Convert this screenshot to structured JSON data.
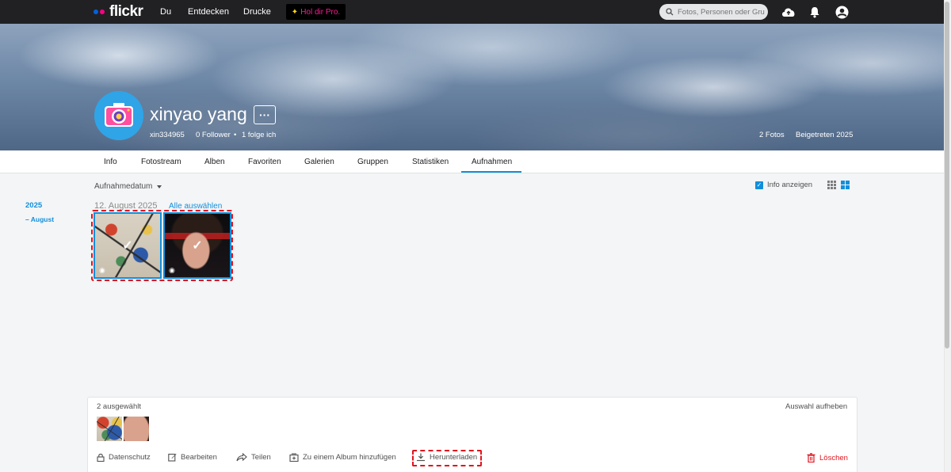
{
  "nav": {
    "logo": "flickr",
    "links": [
      "Du",
      "Entdecken",
      "Drucke"
    ],
    "pro_label": "Hol dir Pro.",
    "search_placeholder": "Fotos, Personen oder Gruppen"
  },
  "profile": {
    "name": "xinyao yang",
    "more_label": "···",
    "handle": "xin334965",
    "followers": "0 Follower",
    "following": "1 folge ich",
    "photos": "2 Fotos",
    "joined": "Beigetreten 2025"
  },
  "tabs": [
    "Info",
    "Fotostream",
    "Alben",
    "Favoriten",
    "Galerien",
    "Gruppen",
    "Statistiken",
    "Aufnahmen"
  ],
  "active_tab": "Aufnahmen",
  "toolbar": {
    "sort_label": "Aufnahmedatum",
    "info_label": "Info anzeigen"
  },
  "timeline": {
    "year": "2025",
    "month": "August"
  },
  "section": {
    "date": "12. August 2025",
    "select_all": "Alle auswählen"
  },
  "selection": {
    "count_label": "2 ausgewählt",
    "deselect_label": "Auswahl aufheben",
    "actions": {
      "privacy": "Datenschutz",
      "edit": "Bearbeiten",
      "share": "Teilen",
      "album": "Zu einem Album hinzufügen",
      "download": "Herunterladen",
      "delete": "Löschen"
    }
  },
  "colors": {
    "accent": "#128fdc",
    "danger": "#e0141e",
    "logo_blue": "#0063dc",
    "logo_pink": "#ff0084"
  }
}
